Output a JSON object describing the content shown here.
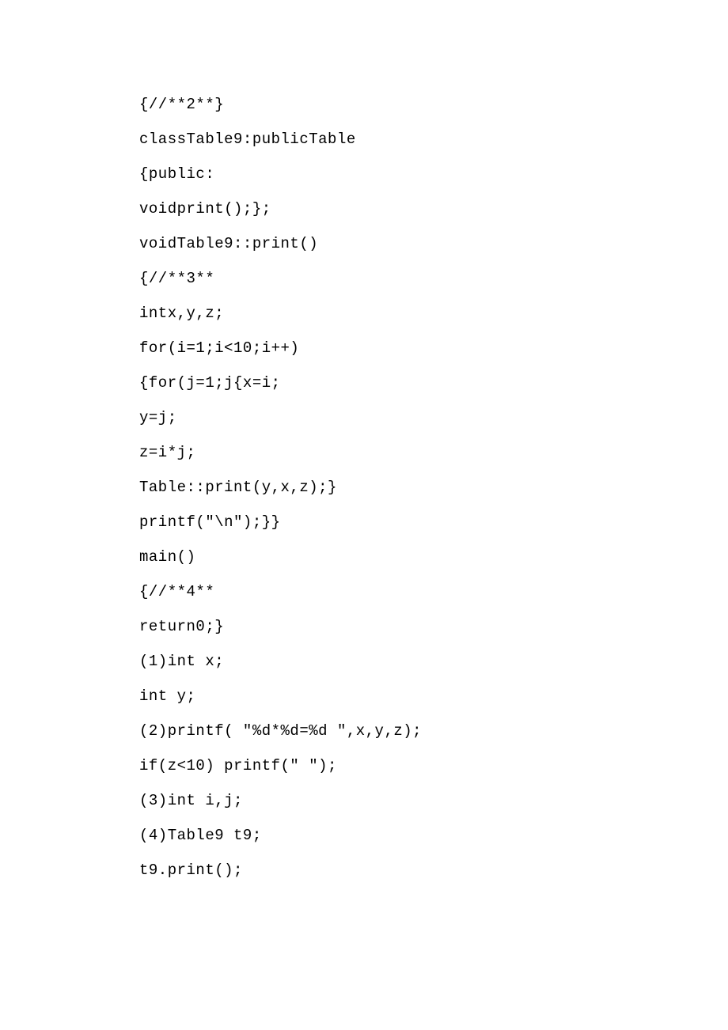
{
  "lines": [
    "{//**2**}",
    "classTable9:publicTable",
    "{public:",
    "voidprint();};",
    "voidTable9::print()",
    "{//**3**",
    "intx,y,z;",
    "for(i=1;i<10;i++)",
    "{for(j=1;j{x=i;",
    "y=j;",
    "z=i*j;",
    "Table::print(y,x,z);}",
    "printf(\"\\n\");}}",
    "main()",
    "{//**4**",
    "return0;}",
    "(1)int x;",
    "int y;",
    "(2)printf( \"%d*%d=%d \",x,y,z);",
    "if(z<10) printf(\" \");",
    "(3)int i,j;",
    "(4)Table9 t9;",
    "t9.print();"
  ]
}
